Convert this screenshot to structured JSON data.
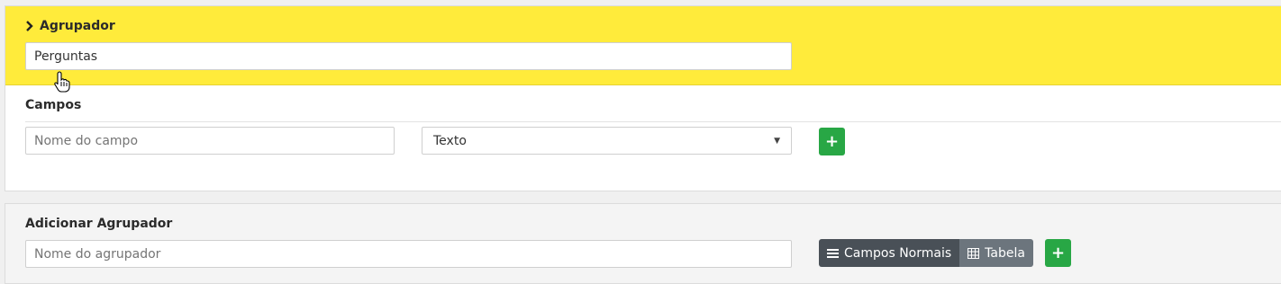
{
  "groupBlock": {
    "title": "Agrupador",
    "name_value": "Perguntas"
  },
  "fields": {
    "title": "Campos",
    "name_placeholder": "Nome do campo",
    "type_selected": "Texto",
    "add_label": "+"
  },
  "addGroup": {
    "title": "Adicionar Agrupador",
    "name_placeholder": "Nome do agrupador",
    "mode_normal": "Campos Normais",
    "mode_table": "Tabela",
    "add_label": "+"
  },
  "colors": {
    "highlight": "#ffeb3b",
    "success": "#28a745",
    "active_segment": "#495057",
    "inactive_segment": "#6c757d"
  }
}
